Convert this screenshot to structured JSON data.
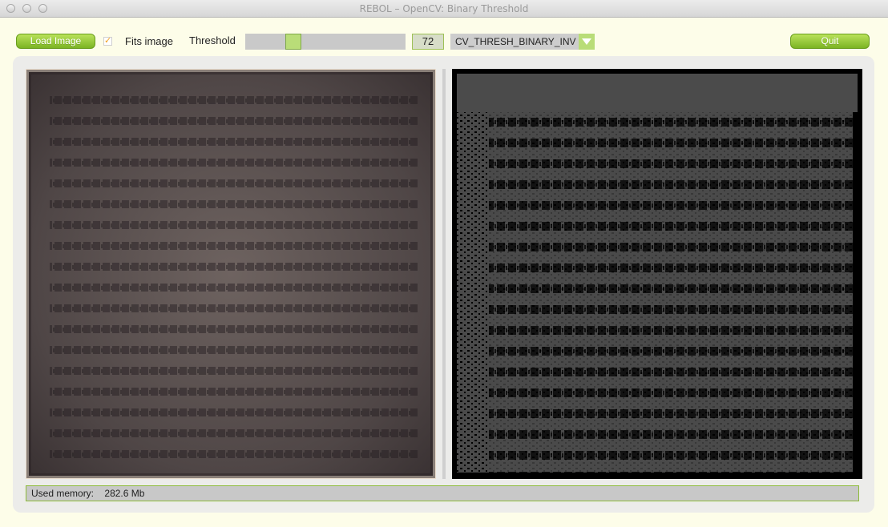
{
  "window": {
    "title": "REBOL – OpenCV: Binary Threshold"
  },
  "toolbar": {
    "load_label": "Load Image",
    "fits_checked": true,
    "fits_label": "Fits image",
    "threshold_label": "Threshold",
    "threshold_value": "72",
    "threshold_fraction": 0.28,
    "mode_selected": "CV_THRESH_BINARY_INV",
    "quit_label": "Quit"
  },
  "status": {
    "label": "Used memory:",
    "value": "282.6 Mb"
  },
  "colors": {
    "accent": "#8cc63f",
    "background": "#fdfde9"
  },
  "icons": {
    "checkbox": "checkmark-icon",
    "dropdown": "chevron-down-icon"
  }
}
